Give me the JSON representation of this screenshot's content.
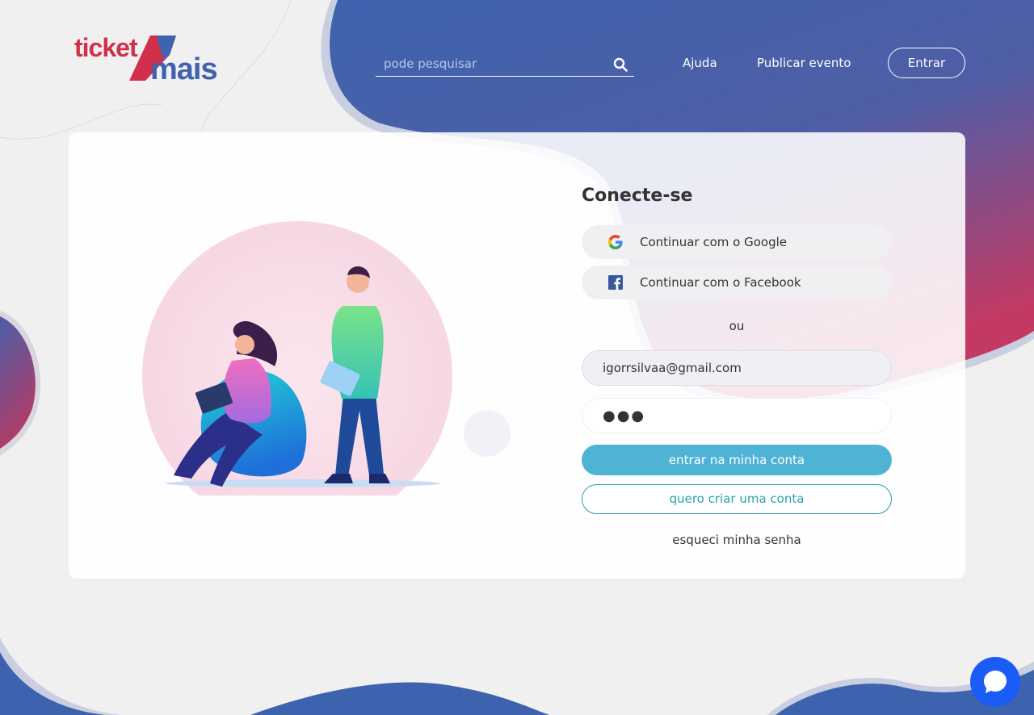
{
  "header": {
    "logo_text_top": "ticket",
    "logo_text_bottom": "mais",
    "search_placeholder": "pode pesquisar",
    "nav": {
      "help": "Ajuda",
      "publish": "Publicar evento",
      "login": "Entrar"
    }
  },
  "login": {
    "title": "Conecte-se",
    "google_label": "Continuar com o Google",
    "facebook_label": "Continuar com o Facebook",
    "separator": "ou",
    "email_value": "igorrsilvaa@gmail.com",
    "password_value": "●●●",
    "submit_label": "entrar na minha conta",
    "create_label": "quero criar uma conta",
    "forgot_label": "esqueci minha senha"
  },
  "icons": {
    "search": "search-icon",
    "google": "google-icon",
    "facebook": "facebook-icon",
    "chat": "chat-icon"
  },
  "colors": {
    "brand_blue": "#3f63b0",
    "brand_red": "#d0304a",
    "primary_button": "#4fb3d6",
    "secondary_button_border": "#2aa3a8",
    "chat_button": "#1a5cf5"
  }
}
